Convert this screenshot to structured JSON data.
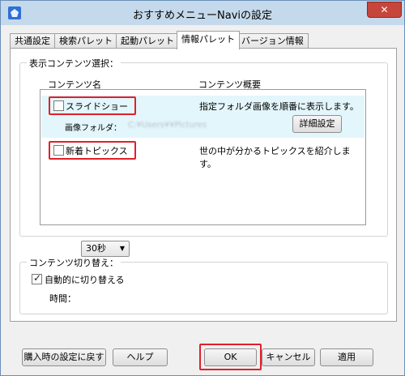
{
  "window": {
    "title": "おすすめメニューNaviの設定",
    "close_label": "✕"
  },
  "tabs": [
    {
      "label": "共通設定",
      "active": false
    },
    {
      "label": "検索パレット",
      "active": false
    },
    {
      "label": "起動パレット",
      "active": false
    },
    {
      "label": "情報パレット",
      "active": true
    },
    {
      "label": "バージョン情報",
      "active": false
    }
  ],
  "content_select": {
    "group_label": "表示コンテンツ選択：",
    "col_name": "コンテンツ名",
    "col_desc": "コンテンツ概要",
    "items": [
      {
        "name": "スライドショー",
        "checked": false,
        "desc": "指定フォルダ画像を順番に表示します。",
        "folder_label": "画像フォルダ：",
        "folder_path": "C:¥Users¥¥Pictures",
        "detail_button": "詳細設定"
      },
      {
        "name": "新着トピックス",
        "checked": false,
        "desc": "世の中が分かるトピックスを紹介します。"
      }
    ]
  },
  "content_switch": {
    "group_label": "コンテンツ切り替え：",
    "auto_label": "自動的に切り替える",
    "auto_checked": true,
    "time_label": "時間：",
    "time_value": "30秒"
  },
  "footer": {
    "reset_button": "購入時の設定に戻す",
    "help_button": "ヘルプ",
    "ok_button": "OK",
    "cancel_button": "キャンセル",
    "apply_button": "適用"
  },
  "colors": {
    "highlight": "#e0202a",
    "selected_row": "#e3f6fb",
    "titlebar": "#c5d9ec"
  }
}
